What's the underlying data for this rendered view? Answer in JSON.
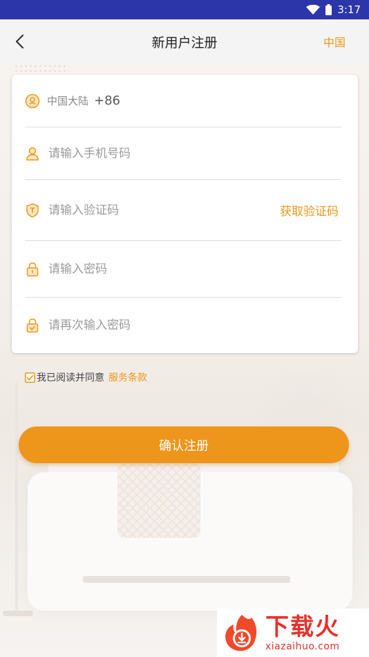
{
  "status_bar": {
    "time": "3:17"
  },
  "header": {
    "title": "新用户注册",
    "back_icon": "chevron-left-icon",
    "region": "中国"
  },
  "form": {
    "country": {
      "label": "中国大陆",
      "code": "+86"
    },
    "phone": {
      "placeholder": "请输入手机号码"
    },
    "verify": {
      "placeholder": "请输入验证码",
      "get_code": "获取验证码"
    },
    "password": {
      "placeholder": "请输入密码"
    },
    "password_confirm": {
      "placeholder": "请再次输入密码"
    }
  },
  "agreement": {
    "text": "我已阅读并同意",
    "terms": "服务条款",
    "checked": true
  },
  "submit": {
    "label": "确认注册"
  },
  "watermark": {
    "cn": "下载火",
    "en": "xiazaihuo.com"
  },
  "colors": {
    "accent": "#ee951c",
    "status_bar": "#2d36a8",
    "watermark": "#e8302a"
  }
}
